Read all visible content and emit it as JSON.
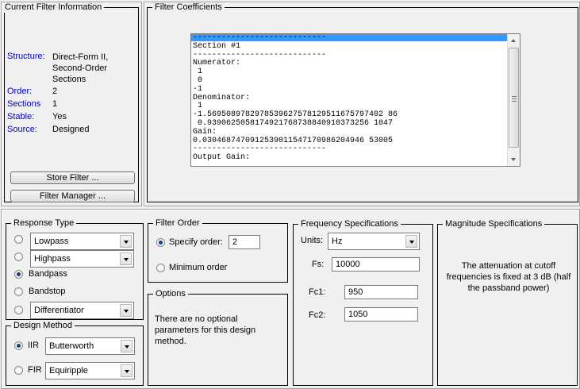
{
  "current_filter": {
    "title": "Current Filter Information",
    "rows": [
      {
        "label": "Structure:",
        "value": "Direct-Form II,\nSecond-Order\nSections"
      },
      {
        "label": "Order:",
        "value": "2"
      },
      {
        "label": "Sections",
        "value": "1"
      },
      {
        "label": "Stable:",
        "value": "Yes"
      },
      {
        "label": "Source:",
        "value": "Designed"
      }
    ],
    "store_button": "Store Filter ...",
    "manager_button": "Filter Manager ..."
  },
  "coefficients": {
    "title": "Filter Coefficients",
    "text": "----------------------------\nSection #1\n----------------------------\nNumerator:\n 1\n 0\n-1\nDenominator:\n 1\n-1.5695089782978539627578129511675797402 86\n 0.9390625058174921768738840910373256 1047\nGain:\n0.0304687470912539011547170986204946 53005\n----------------------------\nOutput Gain:"
  },
  "response_type": {
    "title": "Response Type",
    "options": [
      {
        "label": "Lowpass",
        "selected": false,
        "dropdown": true
      },
      {
        "label": "Highpass",
        "selected": false,
        "dropdown": true
      },
      {
        "label": "Bandpass",
        "selected": true,
        "dropdown": false
      },
      {
        "label": "Bandstop",
        "selected": false,
        "dropdown": false
      },
      {
        "label": "Differentiator",
        "selected": false,
        "dropdown": true
      }
    ]
  },
  "design_method": {
    "title": "Design Method",
    "iir_label": "IIR",
    "iir_value": "Butterworth",
    "fir_label": "FIR",
    "fir_value": "Equiripple",
    "selected": "IIR"
  },
  "filter_order": {
    "title": "Filter Order",
    "specify_label": "Specify order:",
    "specify_value": "2",
    "minimum_label": "Minimum order",
    "selected": "specify"
  },
  "options": {
    "title": "Options",
    "text": "There are no optional parameters for this design method."
  },
  "frequency_specs": {
    "title": "Frequency Specifications",
    "units_label": "Units:",
    "units_value": "Hz",
    "fs_label": "Fs:",
    "fs_value": "10000",
    "fc1_label": "Fc1:",
    "fc1_value": "950",
    "fc2_label": "Fc2:",
    "fc2_value": "1050"
  },
  "magnitude_specs": {
    "title": "Magnitude Specifications",
    "text": "The attenuation at cutoff frequencies is fixed at 3 dB (half the passband power)"
  }
}
